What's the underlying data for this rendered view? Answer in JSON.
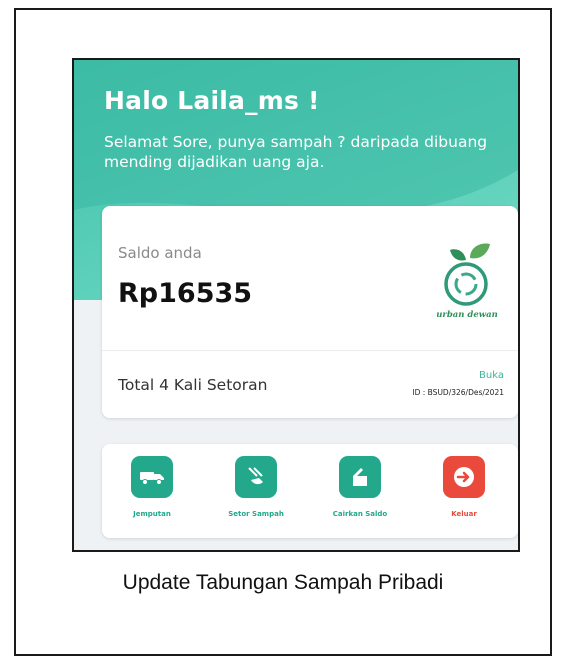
{
  "header": {
    "greeting": "Halo Laila_ms !",
    "subtitle": "Selamat Sore, punya sampah ? daripada dibuang mending dijadikan uang aja."
  },
  "balance_card": {
    "label": "Saldo anda",
    "amount": "Rp16535",
    "logo_text": "urban dewan",
    "total_deposits": "Total 4 Kali Setoran",
    "open_link": "Buka",
    "account_id": "ID : BSUD/326/Des/2021"
  },
  "menu": {
    "items": [
      {
        "label": "Jemputan",
        "icon": "truck-icon",
        "color": "#23a88c"
      },
      {
        "label": "Setor Sampah",
        "icon": "deposit-icon",
        "color": "#23a88c"
      },
      {
        "label": "Cairkan Saldo",
        "icon": "withdraw-icon",
        "color": "#23a88c"
      },
      {
        "label": "Keluar",
        "icon": "logout-icon",
        "color": "#ea4a3c"
      }
    ]
  },
  "caption": "Update Tabungan Sampah Pribadi",
  "colors": {
    "accent": "#3fbfa8",
    "danger": "#ea4a3c",
    "link": "#3cb59b"
  }
}
